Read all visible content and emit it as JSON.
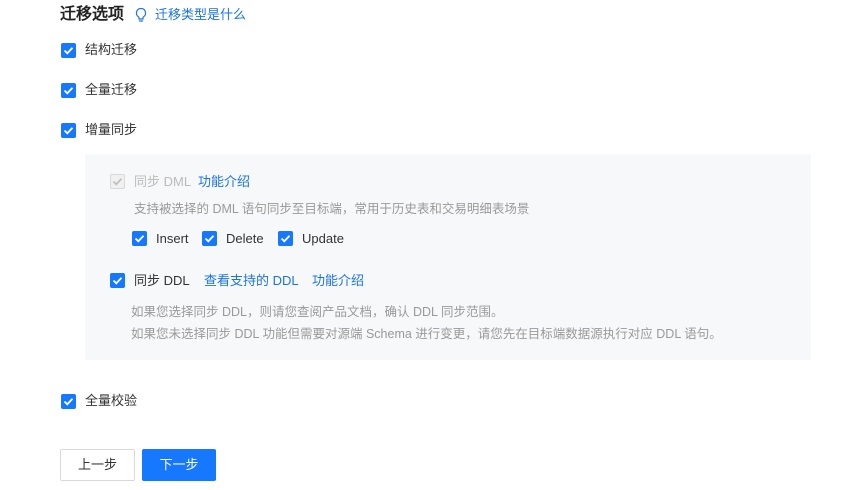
{
  "header": {
    "title": "迁移选项",
    "help_link": "迁移类型是什么",
    "help_icon": "lightbulb-icon"
  },
  "options": {
    "schema_migration": {
      "label": "结构迁移",
      "checked": true
    },
    "full_migration": {
      "label": "全量迁移",
      "checked": true
    },
    "incremental_sync": {
      "label": "增量同步",
      "checked": true
    },
    "full_verification": {
      "label": "全量校验",
      "checked": true
    }
  },
  "incremental_panel": {
    "sync_dml": {
      "label": "同步 DML",
      "link": "功能介绍",
      "checked": true,
      "disabled": true,
      "description": "支持被选择的 DML 语句同步至目标端，常用于历史表和交易明细表场景",
      "operations": [
        {
          "label": "Insert",
          "checked": true
        },
        {
          "label": "Delete",
          "checked": true
        },
        {
          "label": "Update",
          "checked": true
        }
      ]
    },
    "sync_ddl": {
      "label": "同步 DDL",
      "link_supported": "查看支持的 DDL",
      "link_intro": "功能介绍",
      "checked": true,
      "notes": [
        "如果您选择同步 DDL，则请您查阅产品文档，确认 DDL 同步范围。",
        "如果您未选择同步 DDL 功能但需要对源端 Schema 进行变更，请您先在目标端数据源执行对应 DDL 语句。"
      ]
    }
  },
  "footer": {
    "prev_label": "上一步",
    "next_label": "下一步"
  },
  "colors": {
    "primary": "#1677ff",
    "link": "#1a73e8",
    "panel_bg": "#f7f8fa"
  }
}
